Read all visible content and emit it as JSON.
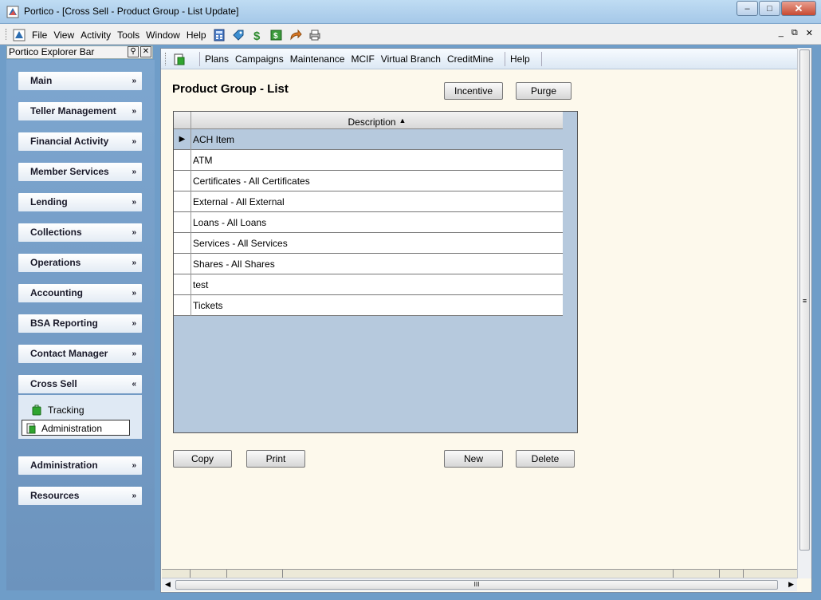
{
  "window": {
    "title": "Portico - [Cross Sell - Product Group - List Update]",
    "controls": {
      "minimize": "–",
      "maximize": "□",
      "close": "✕"
    }
  },
  "menubar": {
    "items": [
      "File",
      "View",
      "Activity",
      "Tools",
      "Window",
      "Help"
    ],
    "mdi": {
      "minimize": "_",
      "restore": "⧉",
      "close": "✕"
    }
  },
  "explorer": {
    "header": "Portico Explorer Bar",
    "items": [
      {
        "label": "Main",
        "chevron": "»"
      },
      {
        "label": "Teller Management",
        "chevron": "»"
      },
      {
        "label": "Financial Activity",
        "chevron": "»"
      },
      {
        "label": "Member Services",
        "chevron": "»"
      },
      {
        "label": "Lending",
        "chevron": "»"
      },
      {
        "label": "Collections",
        "chevron": "»"
      },
      {
        "label": "Operations",
        "chevron": "»"
      },
      {
        "label": "Accounting",
        "chevron": "»"
      },
      {
        "label": "BSA Reporting",
        "chevron": "»"
      },
      {
        "label": "Contact Manager",
        "chevron": "»"
      },
      {
        "label": "Cross Sell",
        "chevron": "«"
      },
      {
        "label": "Administration",
        "chevron": "»"
      },
      {
        "label": "Resources",
        "chevron": "»"
      }
    ],
    "crosssell_sub": [
      "Tracking",
      "Administration"
    ]
  },
  "toolbar": {
    "items": [
      "Plans",
      "Campaigns",
      "Maintenance",
      "MCIF",
      "Virtual Branch",
      "CreditMine"
    ],
    "help": "Help"
  },
  "page": {
    "title": "Product Group - List",
    "buttons": {
      "incentive": "Incentive",
      "purge": "Purge",
      "copy": "Copy",
      "print": "Print",
      "new": "New",
      "delete": "Delete"
    }
  },
  "grid": {
    "column": "Description",
    "sort_indicator": "▲",
    "selected_marker": "▶",
    "rows": [
      "ACH Item",
      "ATM",
      "Certificates - All Certificates",
      "External - All External",
      "Loans - All Loans",
      "Services - All Services",
      "Shares - All Shares",
      "test",
      "Tickets"
    ]
  },
  "scroll": {
    "v_grip": "≡",
    "h_grip": "III",
    "left": "◀",
    "right": "▶"
  },
  "colors": {
    "explorer_bg": "#7da6cf",
    "main_bg": "#fdf9ec",
    "grid_bg": "#b6c9dd",
    "selected_row": "#b6c9dd"
  }
}
